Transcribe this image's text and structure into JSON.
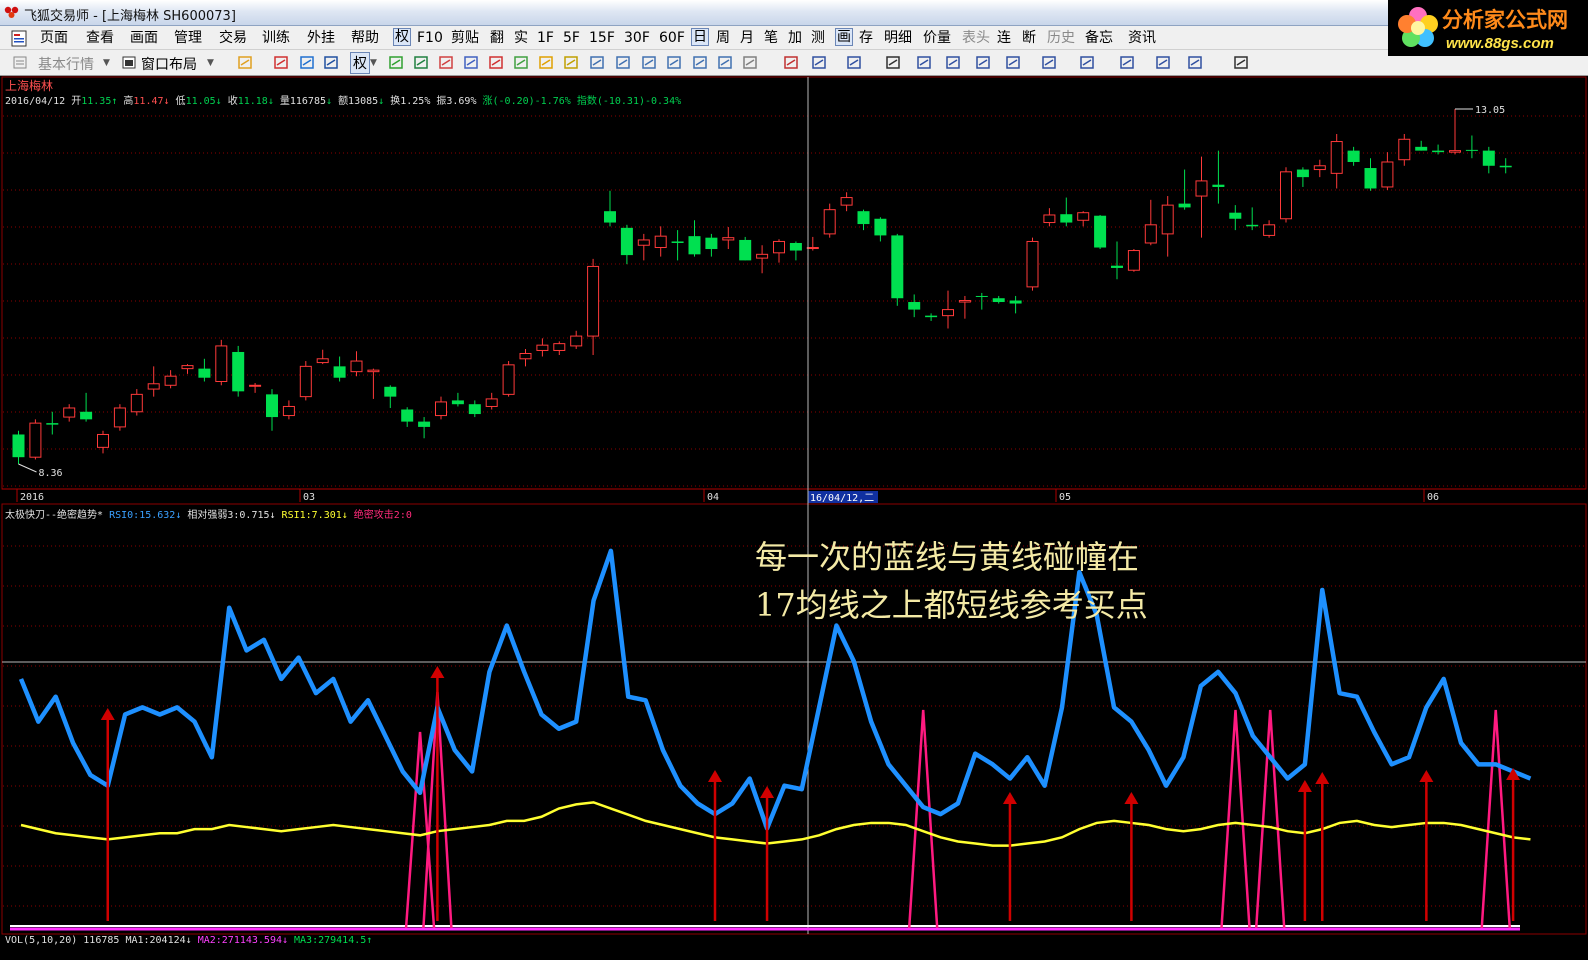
{
  "window": {
    "title": "飞狐交易师 - [上海梅林 SH600073]"
  },
  "brand": {
    "name": "分析家公式网",
    "url": "www.88gs.com"
  },
  "menu": {
    "items": [
      "页面",
      "查看",
      "画面",
      "管理",
      "交易",
      "训练",
      "外挂",
      "帮助",
      "权",
      "F10",
      "剪贴",
      "翻",
      "实",
      "1F",
      "5F",
      "15F",
      "30F",
      "60F",
      "日",
      "周",
      "月",
      "笔",
      "加",
      "测",
      "画",
      "存",
      "明细",
      "价量",
      "表头",
      "连",
      "断",
      "历史",
      "备忘",
      "资讯"
    ],
    "active": [
      "权",
      "日",
      "画"
    ],
    "disabled": [
      "表头",
      "历史"
    ]
  },
  "toolbar": {
    "market_label": "基本行情",
    "layout_label": "窗口布局",
    "fq_label": "权"
  },
  "chart": {
    "stock_name": "上海梅林",
    "date": "2016/04/12",
    "ohlc": [
      {
        "label": "开",
        "value": "11.35",
        "arrow": "↑",
        "color": "#00d050"
      },
      {
        "label": "高",
        "value": "11.47",
        "arrow": "↓",
        "color": "#ff5050"
      },
      {
        "label": "低",
        "value": "11.05",
        "arrow": "↓",
        "color": "#00d050"
      },
      {
        "label": "收",
        "value": "11.18",
        "arrow": "↓",
        "color": "#00d050"
      }
    ],
    "stats": {
      "vol": "量116785",
      "vol_arrow": "↓",
      "amount": "额13085",
      "amount_arrow": "↓",
      "turnover": "换1.25%",
      "amplitude": "振3.69%",
      "change": "涨(-0.20)-1.76%",
      "index": "指数(-10.31)-0.34%"
    },
    "max_price_label": "13.05",
    "min_price_label": "8.36",
    "cursor_date_label": "16/04/12,二",
    "x_axis_labels": [
      "2016",
      "03",
      "04",
      "05",
      "06"
    ],
    "colors": {
      "up": "#ff3a3a",
      "down": "#00e050",
      "grid": "#8b0000",
      "blue_line": "#1e90ff",
      "yellow_line": "#ffff30",
      "pink_line": "#ff1a80",
      "arrow": "#d00000"
    }
  },
  "indicator": {
    "title": "太极快刀--绝密趋势*",
    "values": [
      {
        "text": "RSI0:15.632",
        "arrow": "↓",
        "color": "#3aa0ff"
      },
      {
        "text": "相对强弱3:0.715",
        "arrow": "↓",
        "color": "#e0e0e0"
      },
      {
        "text": "RSI1:7.301",
        "arrow": "↓",
        "color": "#ffff30"
      },
      {
        "text": "绝密攻击2:0",
        "arrow": "",
        "color": "#ff2a7a"
      }
    ]
  },
  "volume": {
    "title": "VOL(5,10,20)",
    "value": "116785",
    "ma": [
      {
        "text": "MA1:204124",
        "arrow": "↓",
        "color": "#e0e0e0"
      },
      {
        "text": "MA2:271143.594",
        "arrow": "↓",
        "color": "#ff40ff"
      },
      {
        "text": "MA3:279414.5",
        "arrow": "↑",
        "color": "#00e050"
      }
    ]
  },
  "annotation": {
    "line1": "每一次的蓝线与黄线碰幢在",
    "line2": "17均线之上都短线参考买点"
  },
  "candles": [
    {
      "o": 8.75,
      "h": 8.8,
      "l": 8.36,
      "c": 8.45
    },
    {
      "o": 8.45,
      "h": 8.95,
      "l": 8.42,
      "c": 8.9
    },
    {
      "o": 8.9,
      "h": 9.05,
      "l": 8.75,
      "c": 8.88
    },
    {
      "o": 8.98,
      "h": 9.15,
      "l": 8.92,
      "c": 9.1
    },
    {
      "o": 9.05,
      "h": 9.3,
      "l": 8.92,
      "c": 8.95
    },
    {
      "o": 8.58,
      "h": 8.8,
      "l": 8.5,
      "c": 8.75
    },
    {
      "o": 8.85,
      "h": 9.15,
      "l": 8.8,
      "c": 9.1
    },
    {
      "o": 9.05,
      "h": 9.35,
      "l": 9.0,
      "c": 9.28
    },
    {
      "o": 9.35,
      "h": 9.65,
      "l": 9.25,
      "c": 9.42
    },
    {
      "o": 9.4,
      "h": 9.6,
      "l": 9.36,
      "c": 9.52
    },
    {
      "o": 9.62,
      "h": 9.68,
      "l": 9.55,
      "c": 9.66
    },
    {
      "o": 9.62,
      "h": 9.75,
      "l": 9.45,
      "c": 9.5
    },
    {
      "o": 9.45,
      "h": 10.0,
      "l": 9.4,
      "c": 9.92
    },
    {
      "o": 9.84,
      "h": 9.92,
      "l": 9.25,
      "c": 9.32
    },
    {
      "o": 9.4,
      "h": 9.43,
      "l": 9.3,
      "c": 9.4
    },
    {
      "o": 9.28,
      "h": 9.35,
      "l": 8.8,
      "c": 8.98
    },
    {
      "o": 9.0,
      "h": 9.2,
      "l": 8.95,
      "c": 9.12
    },
    {
      "o": 9.25,
      "h": 9.72,
      "l": 9.2,
      "c": 9.65
    },
    {
      "o": 9.7,
      "h": 9.87,
      "l": 9.68,
      "c": 9.75
    },
    {
      "o": 9.65,
      "h": 9.78,
      "l": 9.45,
      "c": 9.5
    },
    {
      "o": 9.58,
      "h": 9.85,
      "l": 9.52,
      "c": 9.72
    },
    {
      "o": 9.58,
      "h": 9.62,
      "l": 9.22,
      "c": 9.6
    },
    {
      "o": 9.38,
      "h": 9.4,
      "l": 9.1,
      "c": 9.25
    },
    {
      "o": 9.08,
      "h": 9.11,
      "l": 8.85,
      "c": 8.92
    },
    {
      "o": 8.92,
      "h": 8.98,
      "l": 8.7,
      "c": 8.85
    },
    {
      "o": 9.0,
      "h": 9.25,
      "l": 8.95,
      "c": 9.18
    },
    {
      "o": 9.2,
      "h": 9.3,
      "l": 9.12,
      "c": 9.15
    },
    {
      "o": 9.15,
      "h": 9.2,
      "l": 8.98,
      "c": 9.02
    },
    {
      "o": 9.12,
      "h": 9.3,
      "l": 9.08,
      "c": 9.22
    },
    {
      "o": 9.28,
      "h": 9.72,
      "l": 9.25,
      "c": 9.67
    },
    {
      "o": 9.75,
      "h": 9.88,
      "l": 9.65,
      "c": 9.82
    },
    {
      "o": 9.86,
      "h": 10.02,
      "l": 9.78,
      "c": 9.93
    },
    {
      "o": 9.86,
      "h": 9.98,
      "l": 9.8,
      "c": 9.95
    },
    {
      "o": 9.92,
      "h": 10.12,
      "l": 9.88,
      "c": 10.05
    },
    {
      "o": 10.05,
      "h": 11.07,
      "l": 9.8,
      "c": 10.97
    },
    {
      "o": 11.7,
      "h": 11.97,
      "l": 11.5,
      "c": 11.55
    },
    {
      "o": 11.48,
      "h": 11.52,
      "l": 11.0,
      "c": 11.12
    },
    {
      "o": 11.25,
      "h": 11.4,
      "l": 11.05,
      "c": 11.32
    },
    {
      "o": 11.22,
      "h": 11.5,
      "l": 11.1,
      "c": 11.37
    },
    {
      "o": 11.3,
      "h": 11.45,
      "l": 11.05,
      "c": 11.28
    },
    {
      "o": 11.37,
      "h": 11.58,
      "l": 11.1,
      "c": 11.13
    },
    {
      "o": 11.35,
      "h": 11.4,
      "l": 11.1,
      "c": 11.2
    },
    {
      "o": 11.32,
      "h": 11.49,
      "l": 11.2,
      "c": 11.35
    },
    {
      "o": 11.32,
      "h": 11.36,
      "l": 11.05,
      "c": 11.05
    },
    {
      "o": 11.08,
      "h": 11.25,
      "l": 10.88,
      "c": 11.13
    },
    {
      "o": 11.15,
      "h": 11.33,
      "l": 11.02,
      "c": 11.3
    },
    {
      "o": 11.28,
      "h": 11.3,
      "l": 11.05,
      "c": 11.18
    },
    {
      "o": 11.22,
      "h": 11.36,
      "l": 11.18,
      "c": 11.22
    },
    {
      "o": 11.4,
      "h": 11.8,
      "l": 11.35,
      "c": 11.72
    },
    {
      "o": 11.78,
      "h": 11.95,
      "l": 11.7,
      "c": 11.88
    },
    {
      "o": 11.7,
      "h": 11.72,
      "l": 11.45,
      "c": 11.53
    },
    {
      "o": 11.6,
      "h": 11.62,
      "l": 11.3,
      "c": 11.38
    },
    {
      "o": 11.38,
      "h": 11.4,
      "l": 10.45,
      "c": 10.55
    },
    {
      "o": 10.5,
      "h": 10.6,
      "l": 10.3,
      "c": 10.4
    },
    {
      "o": 10.32,
      "h": 10.35,
      "l": 10.25,
      "c": 10.3
    },
    {
      "o": 10.32,
      "h": 10.65,
      "l": 10.15,
      "c": 10.4
    },
    {
      "o": 10.5,
      "h": 10.58,
      "l": 10.28,
      "c": 10.52
    },
    {
      "o": 10.58,
      "h": 10.62,
      "l": 10.4,
      "c": 10.57
    },
    {
      "o": 10.55,
      "h": 10.58,
      "l": 10.48,
      "c": 10.5
    },
    {
      "o": 10.52,
      "h": 10.58,
      "l": 10.35,
      "c": 10.48
    },
    {
      "o": 10.7,
      "h": 11.35,
      "l": 10.65,
      "c": 11.3
    },
    {
      "o": 11.55,
      "h": 11.74,
      "l": 11.5,
      "c": 11.65
    },
    {
      "o": 11.66,
      "h": 11.88,
      "l": 11.5,
      "c": 11.55
    },
    {
      "o": 11.58,
      "h": 11.7,
      "l": 11.5,
      "c": 11.68
    },
    {
      "o": 11.64,
      "h": 11.65,
      "l": 11.2,
      "c": 11.22
    },
    {
      "o": 10.98,
      "h": 11.3,
      "l": 10.8,
      "c": 10.95
    },
    {
      "o": 10.92,
      "h": 11.2,
      "l": 10.9,
      "c": 11.18
    },
    {
      "o": 11.28,
      "h": 11.85,
      "l": 11.25,
      "c": 11.52
    },
    {
      "o": 11.4,
      "h": 11.9,
      "l": 11.1,
      "c": 11.78
    },
    {
      "o": 11.8,
      "h": 12.25,
      "l": 11.72,
      "c": 11.75
    },
    {
      "o": 11.9,
      "h": 12.42,
      "l": 11.35,
      "c": 12.1
    },
    {
      "o": 12.05,
      "h": 12.5,
      "l": 11.8,
      "c": 12.02
    },
    {
      "o": 11.68,
      "h": 11.78,
      "l": 11.45,
      "c": 11.6
    },
    {
      "o": 11.52,
      "h": 11.75,
      "l": 11.45,
      "c": 11.5
    },
    {
      "o": 11.38,
      "h": 11.58,
      "l": 11.35,
      "c": 11.52
    },
    {
      "o": 11.6,
      "h": 12.28,
      "l": 11.55,
      "c": 12.22
    },
    {
      "o": 12.25,
      "h": 12.28,
      "l": 12.02,
      "c": 12.15
    },
    {
      "o": 12.25,
      "h": 12.38,
      "l": 12.15,
      "c": 12.3
    },
    {
      "o": 12.2,
      "h": 12.72,
      "l": 12.0,
      "c": 12.62
    },
    {
      "o": 12.5,
      "h": 12.55,
      "l": 12.3,
      "c": 12.35
    },
    {
      "o": 12.27,
      "h": 12.4,
      "l": 11.97,
      "c": 12.0
    },
    {
      "o": 12.02,
      "h": 12.48,
      "l": 11.98,
      "c": 12.35
    },
    {
      "o": 12.38,
      "h": 12.72,
      "l": 12.3,
      "c": 12.65
    },
    {
      "o": 12.55,
      "h": 12.63,
      "l": 12.5,
      "c": 12.5
    },
    {
      "o": 12.5,
      "h": 12.58,
      "l": 12.45,
      "c": 12.48
    },
    {
      "o": 12.48,
      "h": 13.05,
      "l": 12.45,
      "c": 12.5
    },
    {
      "o": 12.51,
      "h": 12.7,
      "l": 12.4,
      "c": 12.5
    },
    {
      "o": 12.5,
      "h": 12.55,
      "l": 12.2,
      "c": 12.3
    },
    {
      "o": 12.3,
      "h": 12.4,
      "l": 12.2,
      "c": 12.28
    }
  ],
  "blue_values": [
    70,
    58,
    65,
    52,
    43,
    40,
    60,
    62,
    60,
    62,
    58,
    48,
    90,
    78,
    81,
    70,
    76,
    66,
    70,
    58,
    64,
    54,
    44,
    38,
    62,
    50,
    44,
    72,
    85,
    72,
    60,
    56,
    58,
    92,
    106,
    65,
    64,
    50,
    40,
    35,
    32,
    35,
    42,
    28,
    40,
    39,
    62,
    85,
    75,
    58,
    46,
    40,
    34,
    32,
    35,
    49,
    46,
    42,
    48,
    40,
    62,
    100,
    88,
    62,
    58,
    50,
    40,
    48,
    68,
    72,
    66,
    54,
    48,
    42,
    46,
    95,
    66,
    65,
    55,
    46,
    48,
    62,
    70,
    52,
    46,
    46,
    44,
    42
  ],
  "yellow_values": [
    50,
    48,
    46,
    45,
    44,
    43,
    44,
    45,
    46,
    46,
    48,
    48,
    50,
    49,
    48,
    47,
    48,
    49,
    50,
    49,
    48,
    47,
    46,
    45,
    47,
    48,
    49,
    50,
    52,
    52,
    54,
    58,
    60,
    61,
    58,
    55,
    52,
    50,
    48,
    46,
    44,
    43,
    42,
    41,
    42,
    43,
    45,
    48,
    50,
    51,
    51,
    50,
    47,
    44,
    42,
    41,
    40,
    40,
    41,
    42,
    44,
    48,
    51,
    52,
    51,
    50,
    48,
    47,
    48,
    50,
    51,
    50,
    49,
    47,
    46,
    48,
    51,
    52,
    50,
    49,
    50,
    51,
    51,
    50,
    48,
    46,
    44,
    43
  ],
  "pink_spikes": [
    23,
    24,
    52,
    70,
    72,
    85
  ],
  "red_arrows": [
    5,
    24,
    40,
    43,
    57,
    64,
    74,
    75,
    81,
    86
  ]
}
